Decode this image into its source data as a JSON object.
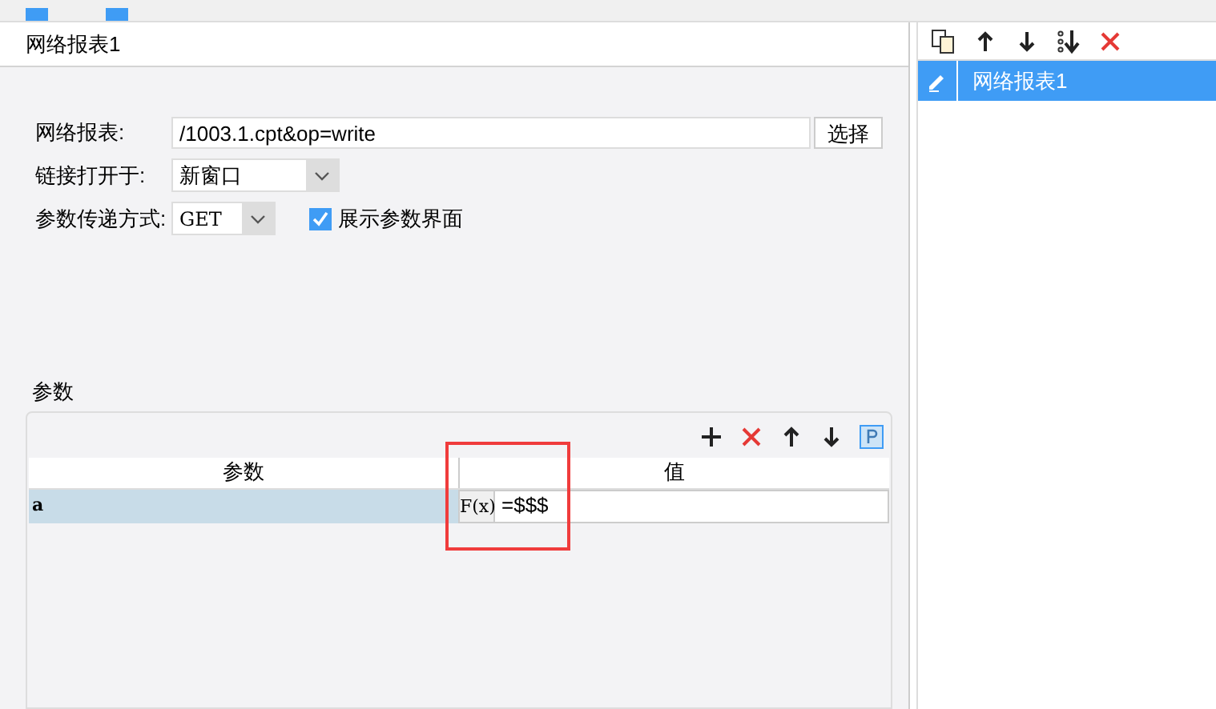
{
  "dialog": {
    "title": "网络报表1"
  },
  "form": {
    "report_label": "网络报表:",
    "report_value": "/1003.1.cpt&op=write",
    "choose_button": "选择",
    "open_label": "链接打开于:",
    "open_value": "新窗口",
    "method_label": "参数传递方式:",
    "method_value": "GET",
    "show_params": {
      "label": "展示参数界面",
      "checked": true
    }
  },
  "params": {
    "legend": "参数",
    "columns": [
      "参数",
      "值"
    ],
    "rows": [
      {
        "name": "a",
        "value": "=$$$",
        "selected": true,
        "formula_button": "F(x)"
      }
    ]
  },
  "side_panel": {
    "items": [
      {
        "label": "网络报表1",
        "selected": true
      }
    ]
  }
}
